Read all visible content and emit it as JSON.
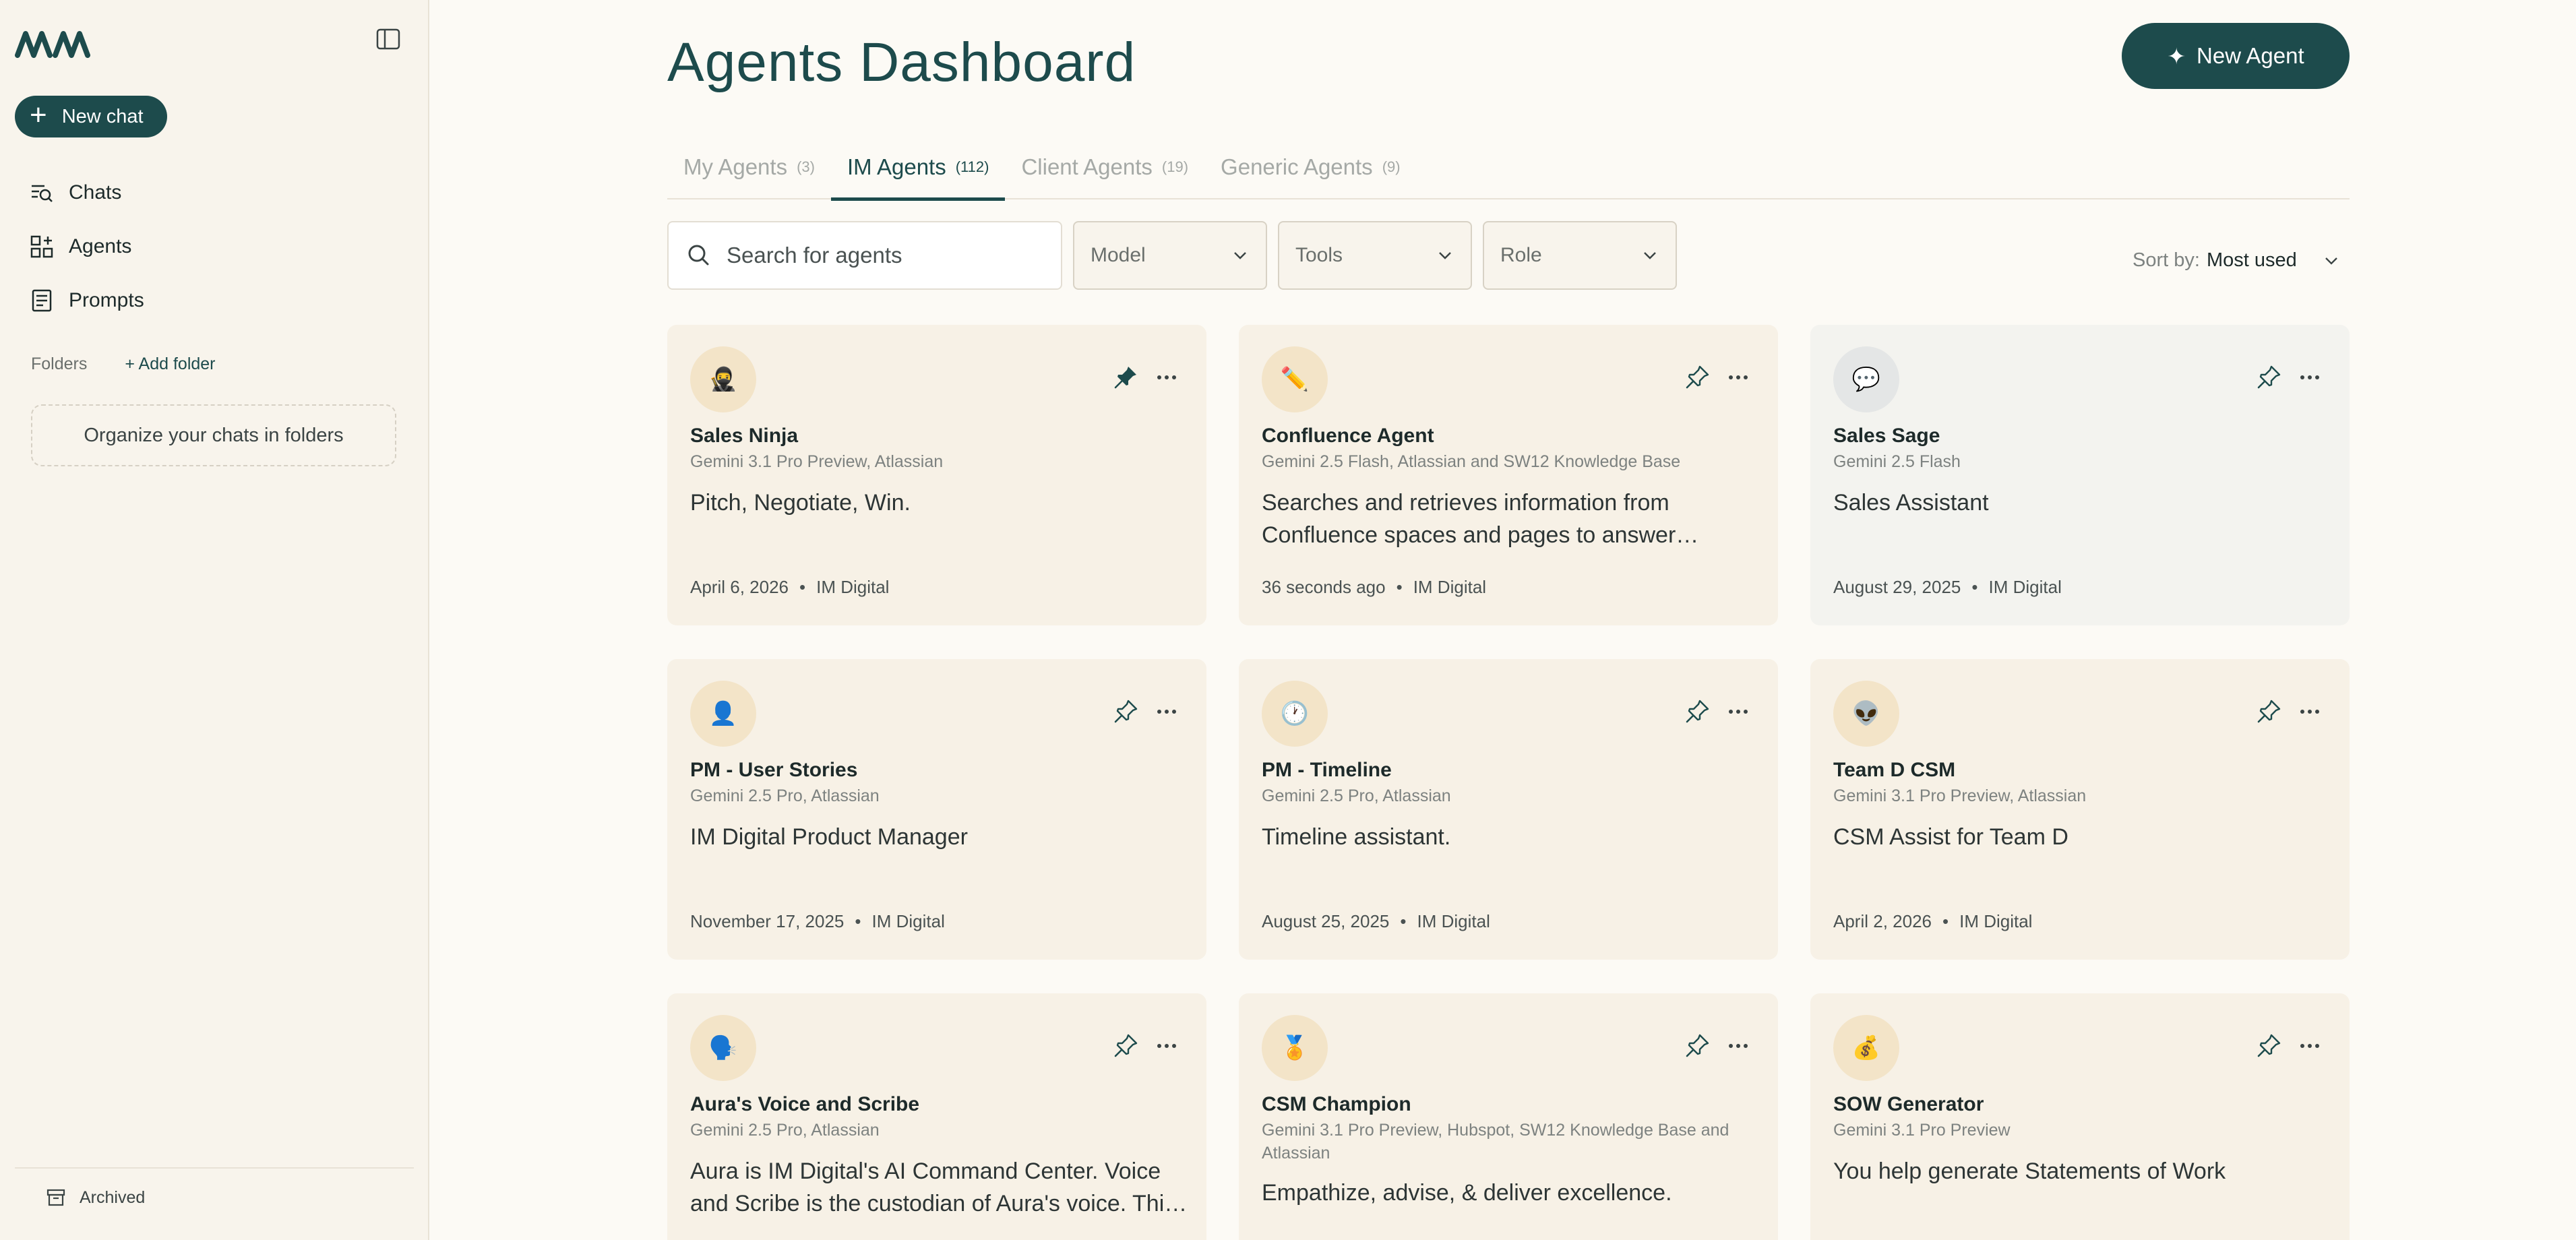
{
  "sidebar": {
    "new_chat_label": "New chat",
    "nav": [
      {
        "label": "Chats",
        "icon": "chats-search-icon"
      },
      {
        "label": "Agents",
        "icon": "agents-grid-icon"
      },
      {
        "label": "Prompts",
        "icon": "prompts-list-icon"
      }
    ],
    "folders_label": "Folders",
    "add_folder_label": "+ Add folder",
    "organize_text": "Organize your chats in folders",
    "archived_label": "Archived"
  },
  "header": {
    "title": "Agents Dashboard",
    "new_agent_label": "New Agent",
    "new_agent_icon": "✦"
  },
  "tabs": [
    {
      "label": "My Agents",
      "count": "(3)",
      "active": false
    },
    {
      "label": "IM Agents",
      "count": "(112)",
      "active": true
    },
    {
      "label": "Client Agents",
      "count": "(19)",
      "active": false
    },
    {
      "label": "Generic Agents",
      "count": "(9)",
      "active": false
    }
  ],
  "filters": {
    "search_placeholder": "Search for agents",
    "model_label": "Model",
    "tools_label": "Tools",
    "role_label": "Role",
    "sort_label": "Sort by:",
    "sort_value": "Most used"
  },
  "agents": [
    {
      "name": "Sales Ninja",
      "model": "Gemini 3.1 Pro Preview, Atlassian",
      "description": "Pitch, Negotiate, Win.",
      "date": "April 6, 2026",
      "owner": "IM Digital",
      "avatar": "🥷",
      "pinned": true,
      "gray": false
    },
    {
      "name": "Confluence Agent",
      "model": "Gemini 2.5 Flash, Atlassian and SW12 Knowledge Base",
      "description": "Searches and retrieves information from Confluence spaces and pages to answer questions.",
      "date": "36 seconds ago",
      "owner": "IM Digital",
      "avatar": "✏️",
      "pinned": false,
      "gray": false
    },
    {
      "name": "Sales Sage",
      "model": "Gemini 2.5 Flash",
      "description": "Sales Assistant",
      "date": "August 29, 2025",
      "owner": "IM Digital",
      "avatar": "💬",
      "pinned": false,
      "gray": true
    },
    {
      "name": "PM - User Stories",
      "model": "Gemini 2.5 Pro, Atlassian",
      "description": "IM Digital Product Manager",
      "date": "November 17, 2025",
      "owner": "IM Digital",
      "avatar": "👤",
      "pinned": false,
      "gray": false
    },
    {
      "name": "PM - Timeline",
      "model": "Gemini 2.5 Pro, Atlassian",
      "description": "Timeline assistant.",
      "date": "August 25, 2025",
      "owner": "IM Digital",
      "avatar": "🕐",
      "pinned": false,
      "gray": false
    },
    {
      "name": "Team D CSM",
      "model": "Gemini 3.1 Pro Preview, Atlassian",
      "description": "CSM Assist for Team D",
      "date": "April 2, 2026",
      "owner": "IM Digital",
      "avatar": "👽",
      "pinned": false,
      "gray": false
    },
    {
      "name": "Aura's Voice and Scribe",
      "model": "Gemini 2.5 Pro, Atlassian",
      "description": "Aura is IM Digital's AI Command Center. Voice and Scribe is the custodian of Aura's voice. This agent...",
      "date": "",
      "owner": "",
      "avatar": "🗣️",
      "pinned": false,
      "gray": false
    },
    {
      "name": "CSM Champion",
      "model": "Gemini 3.1 Pro Preview, Hubspot, SW12 Knowledge Base and Atlassian",
      "description": "Empathize, advise, & deliver excellence.",
      "date": "",
      "owner": "",
      "avatar": "🏅",
      "pinned": false,
      "gray": false
    },
    {
      "name": "SOW Generator",
      "model": "Gemini 3.1 Pro Preview",
      "description": "You help generate Statements of Work",
      "date": "",
      "owner": "",
      "avatar": "💰",
      "pinned": false,
      "gray": false
    }
  ],
  "colors": {
    "accent": "#1d4b4c",
    "card_bg": "#f7f1e6",
    "card_bg_alt": "#f3f3ef",
    "page_bg": "#fcfaf5",
    "sidebar_bg": "#f8f4ec"
  }
}
